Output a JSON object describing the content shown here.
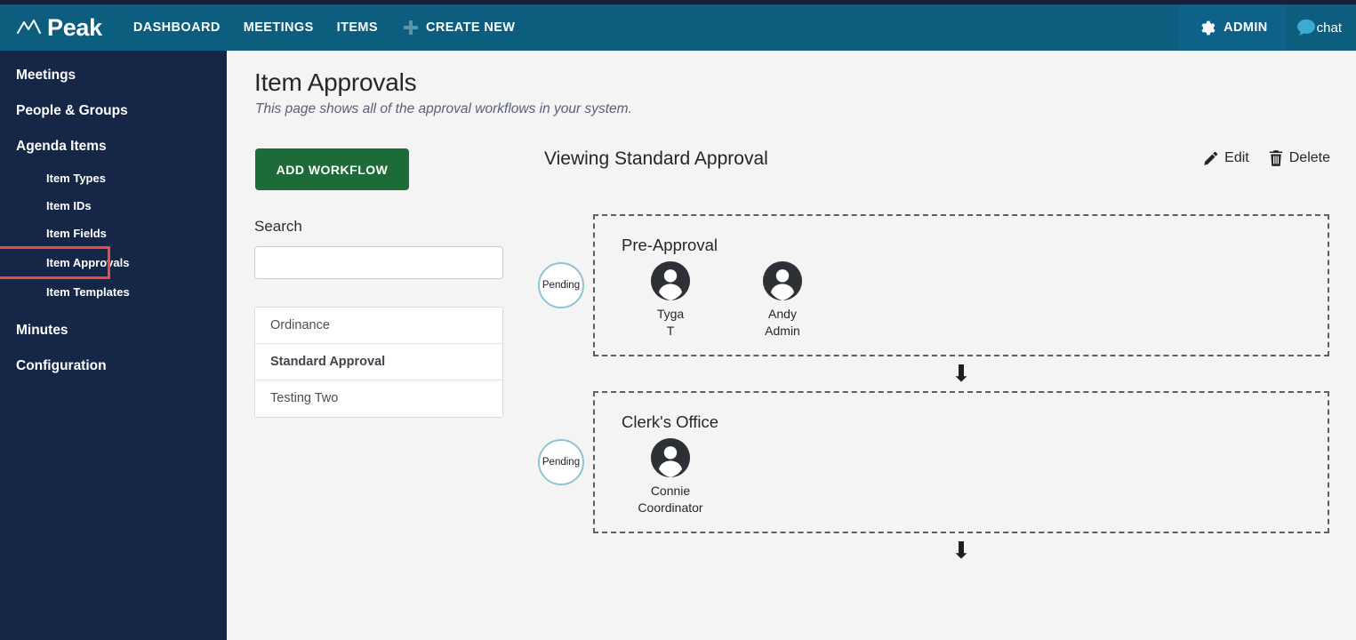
{
  "header": {
    "logo_text": "Peak",
    "logo_icon": "peak-zigzag-icon",
    "nav": [
      {
        "label": "DASHBOARD",
        "name": "dashboard"
      },
      {
        "label": "MEETINGS",
        "name": "meetings"
      },
      {
        "label": "ITEMS",
        "name": "items"
      }
    ],
    "create_new_label": "CREATE NEW",
    "create_new_icon": "plus-icon",
    "admin_label": "ADMIN",
    "admin_icon": "gear-icon",
    "chat_label": "chat",
    "chat_icon": "chat-bubble-icon",
    "bar_color": "#0d5e7e",
    "admin_bg_color": "#0e6289"
  },
  "sidebar": {
    "bg_color": "#152647",
    "highlight_color": "#ef4a41",
    "items": [
      {
        "label": "Meetings",
        "level": "top"
      },
      {
        "label": "People & Groups",
        "level": "top"
      },
      {
        "label": "Agenda Items",
        "level": "top"
      },
      {
        "label": "Item Types",
        "level": "sub"
      },
      {
        "label": "Item IDs",
        "level": "sub"
      },
      {
        "label": "Item Fields",
        "level": "sub"
      },
      {
        "label": "Item Approvals",
        "level": "sub",
        "highlighted": true
      },
      {
        "label": "Item Templates",
        "level": "sub"
      },
      {
        "label": "Minutes",
        "level": "top"
      },
      {
        "label": "Configuration",
        "level": "top"
      }
    ]
  },
  "main": {
    "page_title": "Item Approvals",
    "page_subtitle": "This page shows all of the approval workflows in your system.",
    "add_workflow_label": "ADD WORKFLOW",
    "add_workflow_color": "#1d6b37",
    "search_label": "Search",
    "search_value": "",
    "search_placeholder": "",
    "workflow_list": [
      {
        "label": "Ordinance",
        "selected": false
      },
      {
        "label": "Standard Approval",
        "selected": true
      },
      {
        "label": "Testing Two",
        "selected": false
      }
    ],
    "viewing_title": "Viewing Standard Approval",
    "edit_label": "Edit",
    "edit_icon": "pencil-icon",
    "delete_label": "Delete",
    "delete_icon": "trash-icon",
    "arrow_glyph": "⬇",
    "steps": [
      {
        "status": "Pending",
        "title": "Pre-Approval",
        "people": [
          {
            "name": "Tyga\nT"
          },
          {
            "name": "Andy\nAdmin"
          }
        ]
      },
      {
        "status": "Pending",
        "title": "Clerk's Office",
        "people": [
          {
            "name": "Connie\nCoordinator"
          }
        ]
      }
    ]
  }
}
